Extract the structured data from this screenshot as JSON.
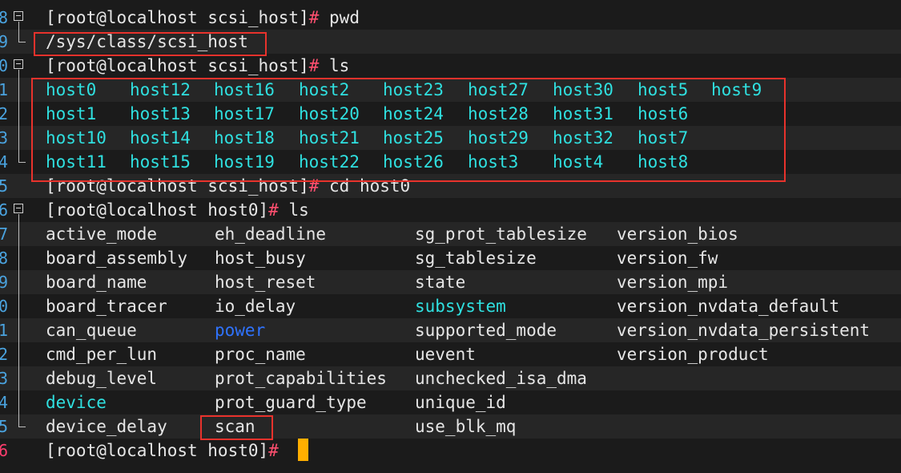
{
  "gutter": [
    "8",
    "9",
    "0",
    "1",
    "2",
    "3",
    "4",
    "5",
    "6",
    "7",
    "8",
    "9",
    "0",
    "1",
    "2",
    "3",
    "4",
    "5",
    "6"
  ],
  "prompt_scsi": "[root@localhost scsi_host]",
  "prompt_host0": "[root@localhost host0]",
  "hash": "#",
  "cmd_pwd": " pwd",
  "pwd_output": "/sys/class/scsi_host",
  "cmd_ls": " ls",
  "cmd_cd": " cd host0",
  "hosts": [
    [
      "host0",
      "host12",
      "host16",
      "host2",
      "host23",
      "host27",
      "host30",
      "host5",
      "host9"
    ],
    [
      "host1",
      "host13",
      "host17",
      "host20",
      "host24",
      "host28",
      "host31",
      "host6",
      ""
    ],
    [
      "host10",
      "host14",
      "host18",
      "host21",
      "host25",
      "host29",
      "host32",
      "host7",
      ""
    ],
    [
      "host11",
      "host15",
      "host19",
      "host22",
      "host26",
      "host3",
      "host4",
      "host8",
      ""
    ]
  ],
  "host0_files": [
    [
      "active_mode",
      "eh_deadline",
      "sg_prot_tablesize",
      "version_bios"
    ],
    [
      "board_assembly",
      "host_busy",
      "sg_tablesize",
      "version_fw"
    ],
    [
      "board_name",
      "host_reset",
      "state",
      "version_mpi"
    ],
    [
      "board_tracer",
      "io_delay",
      "subsystem",
      "version_nvdata_default"
    ],
    [
      "can_queue",
      "power",
      "supported_mode",
      "version_nvdata_persistent"
    ],
    [
      "cmd_per_lun",
      "proc_name",
      "uevent",
      "version_product"
    ],
    [
      "debug_level",
      "prot_capabilities",
      "unchecked_isa_dma",
      ""
    ],
    [
      "device",
      "prot_guard_type",
      "unique_id",
      ""
    ],
    [
      "device_delay",
      "scan",
      "use_blk_mq",
      ""
    ]
  ],
  "colors": {
    "link": "#2fe0e0",
    "dir": "#2f73ff",
    "hash": "#ff4f6f",
    "cursor": "#ffae00",
    "highlight": "#e8322c"
  }
}
